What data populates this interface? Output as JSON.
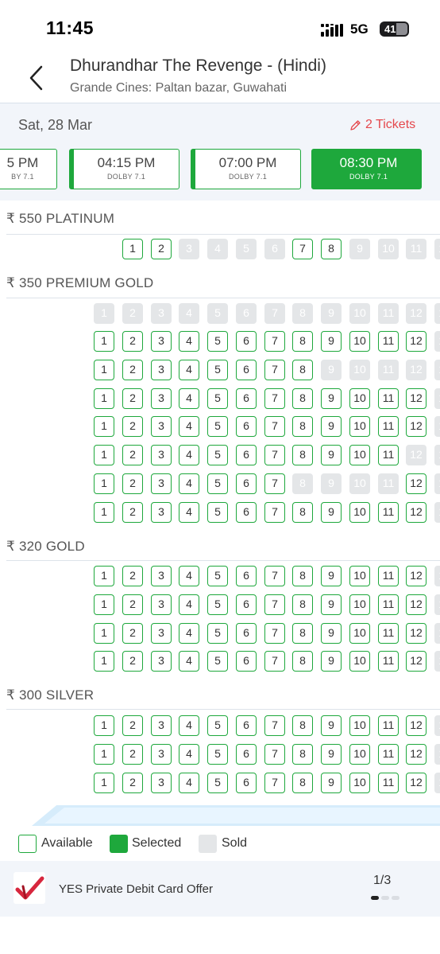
{
  "status_bar": {
    "time": "11:45",
    "network": "5G",
    "battery": "41"
  },
  "header": {
    "title": "Dhurandhar The Revenge - (Hindi)",
    "subtitle": "Grande Cines: Paltan bazar, Guwahati"
  },
  "date_bar": {
    "date": "Sat, 28 Mar",
    "tickets_label": "2 Tickets"
  },
  "showtimes": [
    {
      "time": "5 PM",
      "format": "BY 7.1",
      "selected": false
    },
    {
      "time": "04:15 PM",
      "format": "DOLBY 7.1",
      "selected": false
    },
    {
      "time": "07:00 PM",
      "format": "DOLBY 7.1",
      "selected": false
    },
    {
      "time": "08:30 PM",
      "format": "DOLBY 7.1",
      "selected": true
    }
  ],
  "sections": [
    {
      "name": "₹ 550 PLATINUM",
      "rows": [
        {
          "available": [
            1,
            2,
            7,
            8
          ]
        }
      ]
    },
    {
      "name": "₹ 350 PREMIUM GOLD",
      "rows": [
        {
          "available": []
        },
        {
          "available": [
            1,
            2,
            3,
            4,
            5,
            6,
            7,
            8,
            9,
            10,
            11,
            12
          ]
        },
        {
          "available": [
            1,
            2,
            3,
            4,
            5,
            6,
            7,
            8
          ]
        },
        {
          "available": [
            1,
            2,
            3,
            4,
            5,
            6,
            7,
            8,
            9,
            10,
            11,
            12
          ]
        },
        {
          "available": [
            1,
            2,
            3,
            4,
            5,
            6,
            7,
            8,
            9,
            10,
            11,
            12
          ]
        },
        {
          "available": [
            1,
            2,
            3,
            4,
            5,
            6,
            7,
            8,
            9,
            10,
            11
          ]
        },
        {
          "available": [
            1,
            2,
            3,
            4,
            5,
            6,
            7,
            12
          ]
        },
        {
          "available": [
            1,
            2,
            3,
            4,
            5,
            6,
            7,
            8,
            9,
            10,
            11,
            12
          ]
        }
      ]
    },
    {
      "name": "₹ 320 GOLD",
      "rows": [
        {
          "available": [
            1,
            2,
            3,
            4,
            5,
            6,
            7,
            8,
            9,
            10,
            11,
            12
          ]
        },
        {
          "available": [
            1,
            2,
            3,
            4,
            5,
            6,
            7,
            8,
            9,
            10,
            11,
            12
          ]
        },
        {
          "available": [
            1,
            2,
            3,
            4,
            5,
            6,
            7,
            8,
            9,
            10,
            11,
            12
          ]
        },
        {
          "available": [
            1,
            2,
            3,
            4,
            5,
            6,
            7,
            8,
            9,
            10,
            11,
            12
          ]
        }
      ]
    },
    {
      "name": "₹ 300 SILVER",
      "rows": [
        {
          "available": [
            1,
            2,
            3,
            4,
            5,
            6,
            7,
            8,
            9,
            10,
            11,
            12
          ]
        },
        {
          "available": [
            1,
            2,
            3,
            4,
            5,
            6,
            7,
            8,
            9,
            10,
            11,
            12
          ]
        },
        {
          "available": [
            1,
            2,
            3,
            4,
            5,
            6,
            7,
            8,
            9,
            10,
            11,
            12
          ]
        }
      ]
    }
  ],
  "legend": {
    "available": "Available",
    "selected": "Selected",
    "sold": "Sold"
  },
  "offer": {
    "text": "YES Private Debit Card Offer",
    "page": "1/3"
  },
  "colors": {
    "accent": "#1ea83c",
    "sold": "#e4e6e8",
    "tickets": "#e5484d"
  }
}
